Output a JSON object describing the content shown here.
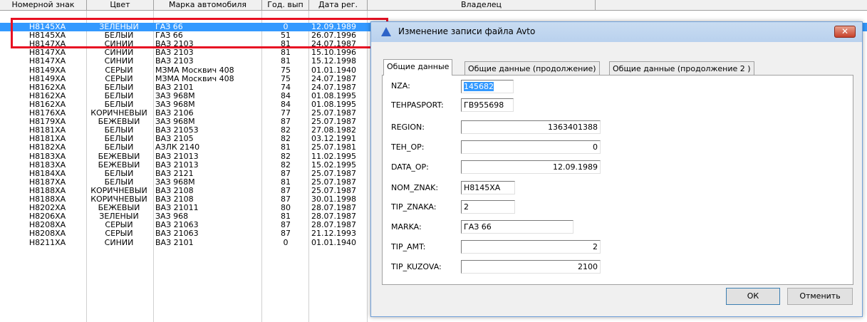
{
  "grid": {
    "headers": [
      "Номерной знак",
      "Цвет",
      "Марка автомобиля",
      "Год. вып",
      "Дата рег.",
      "Владелец"
    ],
    "rows": [
      [
        "Н8145ХА",
        "ЗЕЛЕНЫЙ",
        "ГАЗ 66",
        "0",
        "12.09.1989"
      ],
      [
        "Н8145ХА",
        "БЕЛЫЙ",
        "ГАЗ 66",
        "51",
        "26.07.1996"
      ],
      [
        "Н8147ХА",
        "СИНИЙ",
        "ВАЗ 2103",
        "81",
        "24.07.1987"
      ],
      [
        "Н8147ХА",
        "СИНИЙ",
        "ВАЗ 2103",
        "81",
        "15.10.1996"
      ],
      [
        "Н8147ХА",
        "СИНИЙ",
        "ВАЗ 2103",
        "81",
        "15.12.1998"
      ],
      [
        "Н8149ХА",
        "СЕРЫЙ",
        "МЗМА Москвич 408",
        "75",
        "01.01.1940"
      ],
      [
        "Н8149ХА",
        "СЕРЫЙ",
        "МЗМА Москвич 408",
        "75",
        "24.07.1987"
      ],
      [
        "Н8162ХА",
        "БЕЛЫЙ",
        "ВАЗ 2101",
        "74",
        "24.07.1987"
      ],
      [
        "Н8162ХА",
        "БЕЛЫЙ",
        "ЗАЗ 968М",
        "84",
        "01.08.1995"
      ],
      [
        "Н8162ХА",
        "БЕЛЫЙ",
        "ЗАЗ 968М",
        "84",
        "01.08.1995"
      ],
      [
        "Н8176ХА",
        "КОРИЧНЕВЫЙ",
        "ВАЗ 2106",
        "77",
        "25.07.1987"
      ],
      [
        "Н8179ХА",
        "БЕЖЕВЫЙ",
        "ЗАЗ 968М",
        "87",
        "25.07.1987"
      ],
      [
        "Н8181ХА",
        "БЕЛЫЙ",
        "ВАЗ 21053",
        "82",
        "27.08.1982"
      ],
      [
        "Н8181ХА",
        "БЕЛЫЙ",
        "ВАЗ 2105",
        "82",
        "03.12.1991"
      ],
      [
        "Н8182ХА",
        "БЕЛЫЙ",
        "АЗЛК 2140",
        "81",
        "25.07.1981"
      ],
      [
        "Н8183ХА",
        "БЕЖЕВЫЙ",
        "ВАЗ 21013",
        "82",
        "11.02.1995"
      ],
      [
        "Н8183ХА",
        "БЕЖЕВЫЙ",
        "ВАЗ 21013",
        "82",
        "15.02.1995"
      ],
      [
        "Н8184ХА",
        "БЕЛЫЙ",
        "ВАЗ 2121",
        "87",
        "25.07.1987"
      ],
      [
        "Н8187ХА",
        "БЕЛЫЙ",
        "ЗАЗ 968М",
        "81",
        "25.07.1987"
      ],
      [
        "Н8188ХА",
        "КОРИЧНЕВЫЙ",
        "ВАЗ 2108",
        "87",
        "25.07.1987"
      ],
      [
        "Н8188ХА",
        "КОРИЧНЕВЫЙ",
        "ВАЗ 2108",
        "87",
        "30.01.1998"
      ],
      [
        "Н8202ХА",
        "БЕЖЕВЫЙ",
        "ВАЗ 21011",
        "80",
        "28.07.1987"
      ],
      [
        "Н8206ХА",
        "ЗЕЛЕНЫЙ",
        "ЗАЗ 968",
        "81",
        "28.07.1987"
      ],
      [
        "Н8208ХА",
        "СЕРЫЙ",
        "ВАЗ 21063",
        "87",
        "28.07.1987"
      ],
      [
        "Н8208ХА",
        "СЕРЫЙ",
        "ВАЗ 21063",
        "87",
        "21.12.1993"
      ],
      [
        "Н8211ХА",
        "СИНИЙ",
        "ВАЗ 2101",
        "0",
        "01.01.1940"
      ]
    ],
    "selected_row": 0
  },
  "dialog": {
    "title": "Изменение записи файла Avto",
    "close_glyph": "✕",
    "tabs": [
      "Общие данные",
      "Общие данные (продолжение)",
      "Общие данные (продолжение 2 )"
    ],
    "active_tab": 0,
    "fields": [
      {
        "label": "NZA:",
        "value": "145682"
      },
      {
        "label": "TEHPASPORT:",
        "value": "ГВ955698"
      },
      {
        "label": "REGION:",
        "value": "1363401388"
      },
      {
        "label": "TEH_OP:",
        "value": "0"
      },
      {
        "label": "DATA_OP:",
        "value": "12.09.1989"
      },
      {
        "label": "NOM_ZNAK:",
        "value": "Н8145ХА"
      },
      {
        "label": "TIP_ZNAKA:",
        "value": "2"
      },
      {
        "label": "MARKA:",
        "value": "ГАЗ 66"
      },
      {
        "label": "TIP_AMT:",
        "value": "2"
      },
      {
        "label": "TIP_KUZOVA:",
        "value": "2100"
      }
    ],
    "ok_label": "ОК",
    "cancel_label": "Отменить"
  },
  "colors": {
    "selection": "#3399ff",
    "highlight_box": "#e81123",
    "dialog_title_bg": "#c9dcf1"
  }
}
